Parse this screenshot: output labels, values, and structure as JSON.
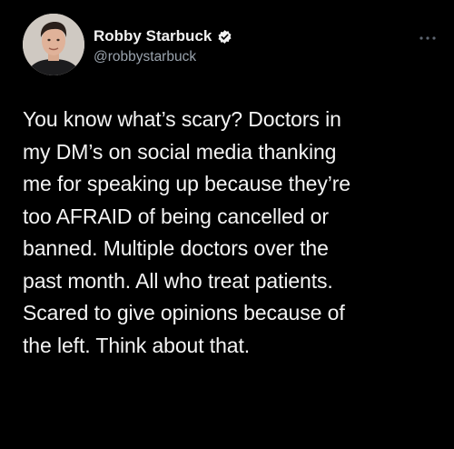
{
  "author": {
    "display_name": "Robby Starbuck",
    "handle": "@robbystarbuck",
    "verified": true,
    "avatar_icon": "profile-photo",
    "verified_icon": "verified-badge-icon",
    "menu_icon": "more-options-icon"
  },
  "tweet": {
    "text": "You know what’s scary? Doctors in\nmy DM’s on social media thanking\nme for speaking up because they’re\ntoo AFRAID of being cancelled or\nbanned. Multiple doctors over the\npast month. All who treat patients.\nScared to give opinions because of\nthe left. Think about that."
  },
  "colors": {
    "background": "#000000",
    "text": "#f4f4f4",
    "handle": "#9aa3ad",
    "verified_badge": "#f2f2f2"
  }
}
